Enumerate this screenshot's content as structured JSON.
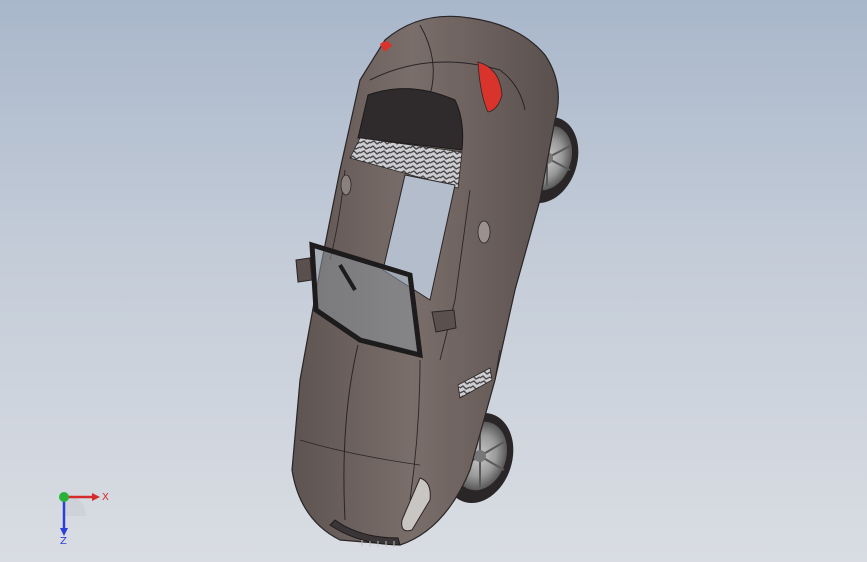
{
  "viewport": {
    "background_top": "#a9b7cb",
    "background_bottom": "#d9dde3"
  },
  "model": {
    "body_color": "#6e6360",
    "glass_color": "#2f2b2d",
    "tail_light_color": "#d9342b",
    "wheel_color": "#3a3638"
  },
  "triad": {
    "x_label": "X",
    "z_label": "Z",
    "x_color": "#d62b2b",
    "y_color": "#27b33a",
    "z_color": "#2b3fd6"
  }
}
